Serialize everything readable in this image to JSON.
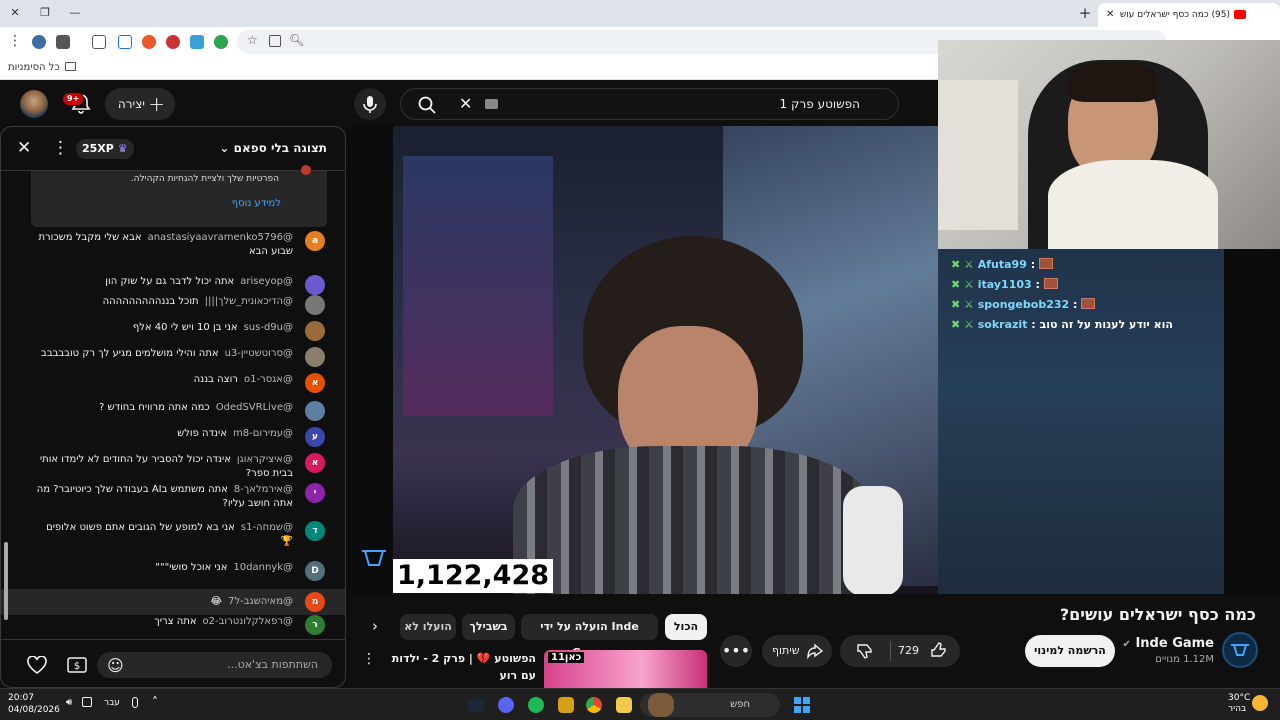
{
  "browser": {
    "tab_title": "(95) כמה כסף ישראלים עוש",
    "bookmarks_label": "כל הסימניות"
  },
  "youtube": {
    "notifications_badge": "9+",
    "create_label": "יצירה",
    "search_query": "הפשוטע פרק 1"
  },
  "chat": {
    "title": "תצוגה בלי ספאם",
    "xp": "25XP",
    "notice_text": "הפרטיות שלך ולציית להנחיות הקהילה.",
    "notice_link": "למידע נוסף",
    "input_placeholder": "השתתפות בצ'אט...",
    "messages": [
      {
        "initial": "a",
        "color": "#e67e22",
        "user": "@anastasiyaavramenko5796",
        "text": "אבא שלי מקבל משכורת שבוע הבא"
      },
      {
        "initial": "",
        "color": "#6a5acd",
        "user": "@ariseyop",
        "text": "אתה יכול לדבר גם על שוק הון"
      },
      {
        "initial": "",
        "color": "#777777",
        "user": "@הדיכאונית_שלך||||",
        "text": "תוכל בננההההההההה"
      },
      {
        "initial": "",
        "color": "#9a6a3c",
        "user": "@sus-d9u",
        "text": "אני בן 10 ויש לי 40 אלף"
      },
      {
        "initial": "",
        "color": "#8b7e6a",
        "user": "@סרוטשטיין-u3",
        "text": "אתה והילי מושלמים מגיע לך רק טובבבבב"
      },
      {
        "initial": "א",
        "color": "#e65100",
        "user": "@אגסר-o1",
        "text": "רוצה בננה"
      },
      {
        "initial": "",
        "color": "#5d7fa3",
        "user": "@OdedSVRLive",
        "text": "כמה אתה מרוויח בחודש ?"
      },
      {
        "initial": "ע",
        "color": "#3949ab",
        "user": "@עמירום-m8",
        "text": "אינדה פולש"
      },
      {
        "initial": "א",
        "color": "#d81b60",
        "user": "@איציקראוגן",
        "text": "אינדה יכול להסביר על החודים לא לימדו אותי בבית ספר?"
      },
      {
        "initial": "י",
        "color": "#8e24aa",
        "user": "@אירמלאך-8",
        "text": "אתה משתמש בAI בעבודה שלך כיוטיובר? מה אתה חושב עליו?"
      },
      {
        "initial": "ד",
        "color": "#00897b",
        "user": "@שמחה-s1",
        "text": "אני בא למופע של הגובים אתם פשוט אלופים 🏆"
      },
      {
        "initial": "D",
        "color": "#546e7a",
        "user": "@10dannyk",
        "text": "אני אוכל סושי\"\"\""
      },
      {
        "initial": "מ",
        "color": "#e64a19",
        "user": "@מאיהשגב-ל7",
        "text": "😂"
      },
      {
        "initial": "ר",
        "color": "#2e7d32",
        "user": "@רפאלקלונטרוב-o2",
        "text": "אתה צריך"
      }
    ]
  },
  "stream_overlay": {
    "lines": [
      {
        "user": "Afuta99",
        "text": ""
      },
      {
        "user": "itay1103",
        "text": ""
      },
      {
        "user": "spongebob232",
        "text": ""
      },
      {
        "user": "sokrazit",
        "text": "הוא יודע לענות על זה טוב"
      }
    ],
    "counter": "1,122,428"
  },
  "video": {
    "title": "כמה כסף ישראלים עושים?",
    "channel": "Inde Game",
    "subscribers": "1.12M מנויים",
    "subscribe_label": "הרשמה למינוי",
    "likes": "729",
    "share_label": "שיתוף"
  },
  "chips": [
    "הכול",
    "הועלה על ידי Inde Game",
    "בשבילך",
    "הועלו לא"
  ],
  "recommended": {
    "title": "הפשוטע 💔 | פרק 2 - ילדות עם רוע",
    "thumb_text": "כאן11"
  },
  "taskbar": {
    "time": "20:07",
    "date": "04/08/2026",
    "lang": "עבר",
    "search_label": "חפש",
    "temp": "30°C",
    "weather": "בהיר"
  }
}
